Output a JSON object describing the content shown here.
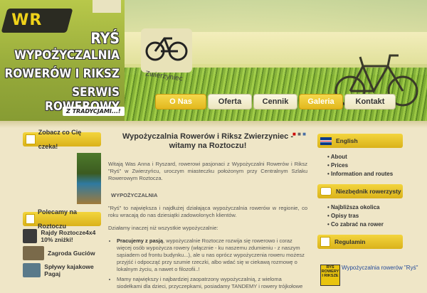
{
  "header": {
    "brand_name": "RYŚ",
    "line1": "WYPOŻYCZALNIA",
    "line2": "ROWERÓW I RIKSZ",
    "line3": "SERWIS ROWEROWY",
    "tagline": "Z TRADYCJAMI...!",
    "logo_text": "WR",
    "road_sign": "Zwierzyniec"
  },
  "nav": {
    "items": [
      "O Nas",
      "Oferta",
      "Cennik",
      "Galeria",
      "Kontakt"
    ],
    "active": "O Nas"
  },
  "left": {
    "box1_title": "Zobacz co Cię czeka!",
    "box2_title": "Polecamy na Roztoczu",
    "rec1": "Rajdy Roztocze4x4 10% zniżki!",
    "rec2": "Zagroda Guciów",
    "rec3": "Spływy kajakowe Pagaj"
  },
  "content": {
    "title": "Wypożyczalnia Rowerów i Riksz Zwierzyniec - witamy na Roztoczu!",
    "intro": "Witają Was Anna i Ryszard, rowerowi pasjonaci z Wypożyczalni Rowerów i Riksz \"Ryś\" w Zwierzyńcu, uroczym miasteczku położonym przy Centralnym Szlaku Rowerowym Roztocza.",
    "section": "WYPOŻYCZALNIA",
    "p1": "\"Ryś\" to największa i najdłużej działająca wypożyczalnia rowerów w regionie, co roku wracają do nas dziesiątki zadowolonych klientów.",
    "p2": "Działamy inaczej niż wszystkie wypożyczalnie:",
    "bullet1_bold": "Pracujemy z pasją",
    "bullet1_text": ", wypożyczalnie Roztocze rozwija się rowerowo i coraz więcej osób wypożycza rowery (włącznie - ku naszemu zdumieniu - z naszym sąsiadem od frontu budynku...), ale u nas oprócz wypożyczenia roweru możesz przyjść i odpocząć przy szumie rzeczki, albo wdać się w ciekawą rozmowę o lokalnym życiu, a nawet o filozofii..!",
    "bullet2_text": "Mamy największy i najbardziej zaopatrzony wypożyczalnią, z wieloma siodełkami dla dzieci, przyczepkami, posiadamy TANDEMY i rowery trójkołowe"
  },
  "right": {
    "lang_label": "English",
    "links": [
      "About",
      "Prices",
      "Information and routes"
    ],
    "box2_title": "Niezbędnik rowerzysty",
    "links2": [
      "Najbliższa okolica",
      "Opisy tras",
      "Co zabrać na rower"
    ],
    "box3_title": "Regulamin",
    "mini_logo": "RYŚ ROWERY I RIKSZE",
    "fb_text": "Wypożyczalnia rowerów \"Ryś\""
  },
  "colors": {
    "accent": "#e3bb1f",
    "background": "#efe6c7",
    "header_green": "#9fb238"
  },
  "icons": [
    "pdf-icon",
    "print-icon",
    "email-icon",
    "uk-flag-icon",
    "bike-icon",
    "fist-icon",
    "arrow-icon"
  ]
}
